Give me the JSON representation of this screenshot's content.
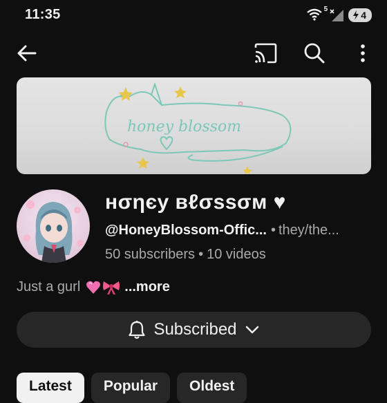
{
  "status_bar": {
    "time": "11:35",
    "wifi_badge": "5",
    "battery_level": "4",
    "icons": [
      "wifi-icon",
      "signal-icon",
      "battery-charging-icon"
    ]
  },
  "toolbar": {
    "icons": [
      "back-arrow-icon",
      "cast-icon",
      "search-icon",
      "more-vertical-icon"
    ]
  },
  "banner": {
    "art_text": "honey blossom"
  },
  "channel": {
    "name": "нσηєу вℓσѕѕσм ♥",
    "handle": "@HoneyBlossom-Offic...",
    "separator": "•",
    "pronouns": "they/the...",
    "subscribers": "50 subscribers",
    "videos": "10 videos"
  },
  "description": {
    "text": "Just a gurl",
    "more_label": "...more"
  },
  "subscribe": {
    "label": "Subscribed",
    "icons": [
      "bell-icon",
      "chevron-down-icon"
    ]
  },
  "tabs": [
    {
      "label": "Latest",
      "active": true
    },
    {
      "label": "Popular",
      "active": false
    },
    {
      "label": "Oldest",
      "active": false
    }
  ],
  "colors": {
    "background": "#0f0f0f",
    "surface": "#272727",
    "text_primary": "#f1f1f1",
    "text_secondary": "#aaaaaa",
    "chip_active": "#f1f1f1"
  }
}
